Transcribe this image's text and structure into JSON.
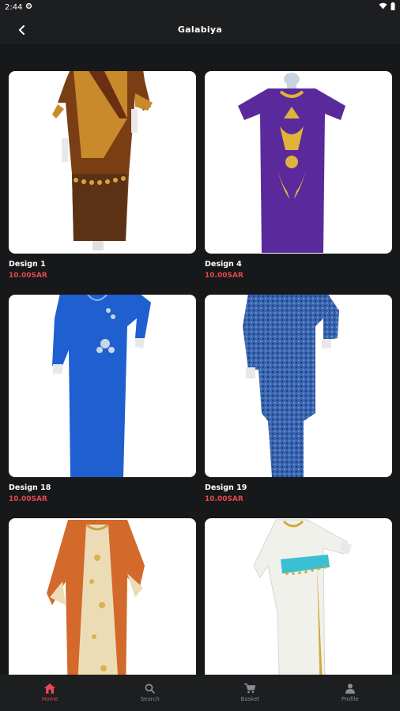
{
  "status_bar": {
    "time": "2:44"
  },
  "app_bar": {
    "title": "Galabiya"
  },
  "products": [
    {
      "name": "Design 1",
      "price": "10.00SAR",
      "image": "brown-orange-galabiya"
    },
    {
      "name": "Design 4",
      "price": "10.00SAR",
      "image": "purple-gold-galabiya"
    },
    {
      "name": "Design 18",
      "price": "10.00SAR",
      "image": "blue-embroidered-galabiya"
    },
    {
      "name": "Design 19",
      "price": "10.00SAR",
      "image": "blue-pattern-galabiya"
    },
    {
      "name": "",
      "price": "",
      "image": "orange-embroidered-galabiya"
    },
    {
      "name": "",
      "price": "",
      "image": "white-turquoise-galabiya"
    }
  ],
  "bottom_nav": [
    {
      "label": "Home",
      "icon": "home-icon",
      "active": true
    },
    {
      "label": "Search",
      "icon": "search-icon",
      "active": false
    },
    {
      "label": "Basket",
      "icon": "cart-icon",
      "active": false
    },
    {
      "label": "Profile",
      "icon": "person-icon",
      "active": false
    }
  ],
  "colors": {
    "accent": "#e6484f",
    "background": "#17181a",
    "bar": "#1d1e20"
  }
}
